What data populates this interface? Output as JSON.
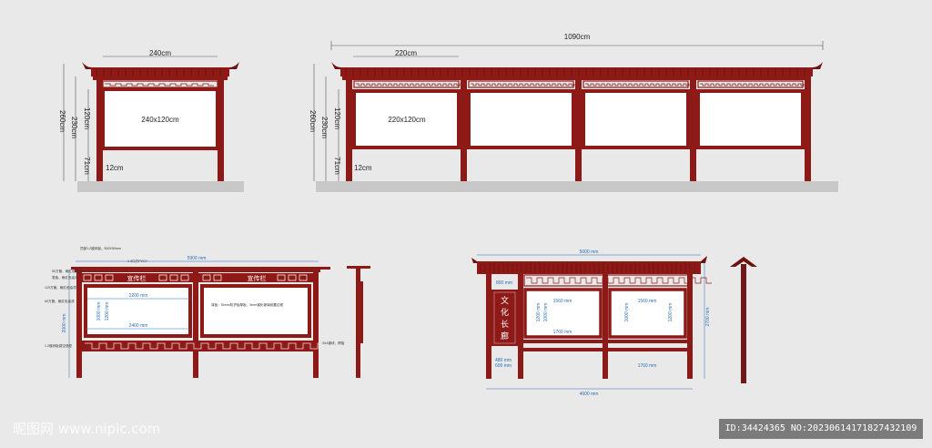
{
  "colors": {
    "frame": "#8e1a18",
    "frame_dark": "#6e1210",
    "ground": "#c8c8c8",
    "board": "#ffffff",
    "dim_line": "#555555",
    "blue_dim": "#2a6fb8"
  },
  "small_elevation": {
    "width_label": "240cm",
    "height_total": "260cm",
    "height_frame": "230cm",
    "board_height": "120cm",
    "leg_height": "71cm",
    "board_label": "240x120cm",
    "post_label": "12cm"
  },
  "long_elevation": {
    "total_width": "1090cm",
    "bay_width": "220cm",
    "height_total": "260cm",
    "height_frame": "230cm",
    "board_height": "120cm",
    "leg_height": "71cm",
    "board_label": "220x120cm",
    "post_label": "12cm",
    "bays": 4
  },
  "drawing_a": {
    "total": "5900 mm",
    "inner_w": "2200 mm",
    "outer_w": "2400 mm",
    "h_left": "2000 mm",
    "h_board_a": "1000 mm",
    "h_board_b": "1200 mm",
    "sign_text": "宣传栏",
    "notes_left": [
      "顶部1.2镀锌板，500X50mm",
      "1.4口方PVCY",
      "50方管，刷红色油漆",
      "表板，刷红色油漆",
      "120方管，刷红色油漆",
      "60方管，刷红色油漆",
      "1.2镀锌板镂空造型"
    ],
    "note_center": "背板：50mm防护板厚板，5mm钢化玻璃前置边框",
    "note_right": "3X4镀锌，焊接"
  },
  "drawing_b": {
    "total_top": "5000 mm",
    "total_bottom": "4600 mm",
    "bay_a": "1560 mm",
    "bay_b": "1560 mm",
    "base_a": "1760 mm",
    "base_b": "1760 mm",
    "height_total": "2700 mm",
    "h_board_a": "1200 mm",
    "h_board_b": "1000 mm",
    "h_board_c": "1000 mm",
    "h_board_d": "1200 mm",
    "side_w_a": "480 mm",
    "side_w_b": "600 mm",
    "side_top": "800 mm",
    "side_text": "文化长廊"
  },
  "watermark": {
    "left": "昵图网 www.nipic.com",
    "right": "ID:34424365 NO:20230614171827432109"
  }
}
